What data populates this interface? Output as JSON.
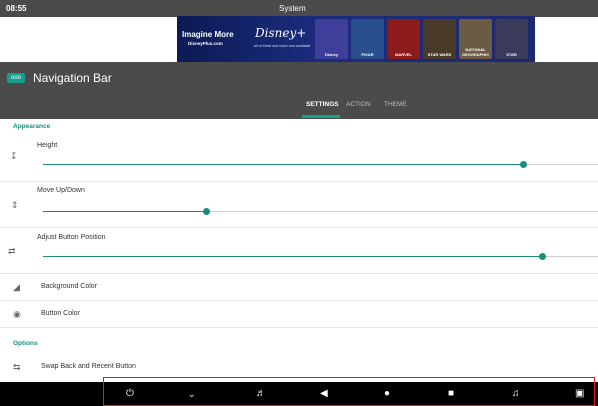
{
  "status_bar": {
    "time": "08:55",
    "title": "System"
  },
  "ad_banner": {
    "headline": "Imagine More",
    "site": "DisneyPlus.com",
    "logo": "Disney+",
    "availability": "All of these and more now available",
    "tiles": [
      {
        "label": "Disney",
        "color": "#3d3f9b"
      },
      {
        "label": "PIXAR",
        "color": "#2a4f8f"
      },
      {
        "label": "MARVEL",
        "color": "#8d1b1b"
      },
      {
        "label": "STAR WARS",
        "color": "#4a3a2a"
      },
      {
        "label": "NATIONAL GEOGRAPHIC",
        "color": "#6b5a44"
      },
      {
        "label": "STAR",
        "color": "#3a3a5a"
      }
    ]
  },
  "app_bar": {
    "title": "Navigation Bar",
    "icon_text": "ooo",
    "tabs": [
      {
        "label": "SETTINGS",
        "active": true
      },
      {
        "label": "ACTION",
        "active": false
      },
      {
        "label": "THEME",
        "active": false
      }
    ]
  },
  "sections": {
    "appearance": "Appearance",
    "options": "Options"
  },
  "settings": {
    "height": {
      "label": "Height",
      "value_fraction": 0.865
    },
    "move": {
      "label": "Move Up/Down",
      "value_fraction": 0.295
    },
    "adjust": {
      "label": "Adjust Button Position",
      "value_fraction": 0.9
    },
    "background_color": {
      "label": "Background Color"
    },
    "button_color": {
      "label": "Button Color"
    },
    "swap": {
      "label": "Swap Back and Recent Button"
    }
  },
  "accent_color": "#16907d",
  "nav_buttons": [
    "power-icon",
    "collapse-icon",
    "volume-down-icon",
    "back-icon",
    "home-icon",
    "recents-icon",
    "volume-up-icon",
    "screenshot-icon"
  ]
}
